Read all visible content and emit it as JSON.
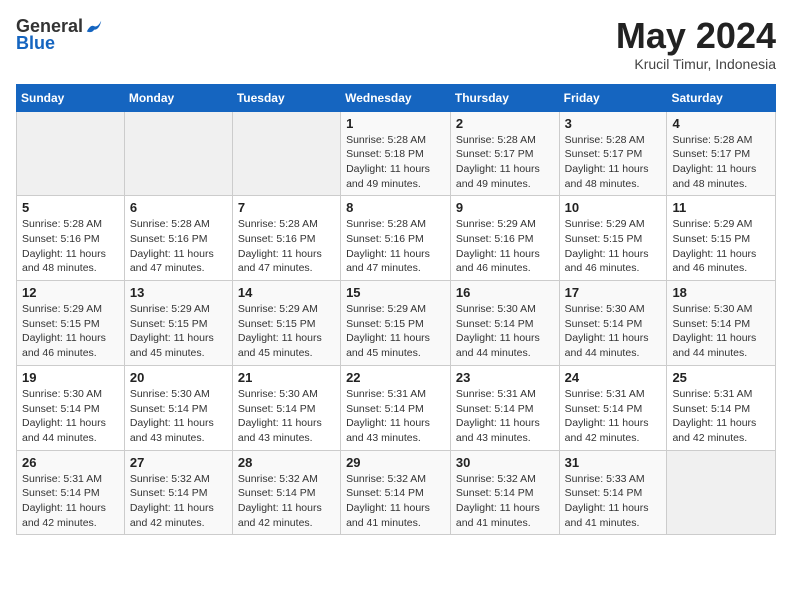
{
  "logo": {
    "general": "General",
    "blue": "Blue"
  },
  "title": "May 2024",
  "subtitle": "Krucil Timur, Indonesia",
  "days_header": [
    "Sunday",
    "Monday",
    "Tuesday",
    "Wednesday",
    "Thursday",
    "Friday",
    "Saturday"
  ],
  "weeks": [
    [
      {
        "day": "",
        "sunrise": "",
        "sunset": "",
        "daylight": ""
      },
      {
        "day": "",
        "sunrise": "",
        "sunset": "",
        "daylight": ""
      },
      {
        "day": "",
        "sunrise": "",
        "sunset": "",
        "daylight": ""
      },
      {
        "day": "1",
        "sunrise": "Sunrise: 5:28 AM",
        "sunset": "Sunset: 5:18 PM",
        "daylight": "Daylight: 11 hours and 49 minutes."
      },
      {
        "day": "2",
        "sunrise": "Sunrise: 5:28 AM",
        "sunset": "Sunset: 5:17 PM",
        "daylight": "Daylight: 11 hours and 49 minutes."
      },
      {
        "day": "3",
        "sunrise": "Sunrise: 5:28 AM",
        "sunset": "Sunset: 5:17 PM",
        "daylight": "Daylight: 11 hours and 48 minutes."
      },
      {
        "day": "4",
        "sunrise": "Sunrise: 5:28 AM",
        "sunset": "Sunset: 5:17 PM",
        "daylight": "Daylight: 11 hours and 48 minutes."
      }
    ],
    [
      {
        "day": "5",
        "sunrise": "Sunrise: 5:28 AM",
        "sunset": "Sunset: 5:16 PM",
        "daylight": "Daylight: 11 hours and 48 minutes."
      },
      {
        "day": "6",
        "sunrise": "Sunrise: 5:28 AM",
        "sunset": "Sunset: 5:16 PM",
        "daylight": "Daylight: 11 hours and 47 minutes."
      },
      {
        "day": "7",
        "sunrise": "Sunrise: 5:28 AM",
        "sunset": "Sunset: 5:16 PM",
        "daylight": "Daylight: 11 hours and 47 minutes."
      },
      {
        "day": "8",
        "sunrise": "Sunrise: 5:28 AM",
        "sunset": "Sunset: 5:16 PM",
        "daylight": "Daylight: 11 hours and 47 minutes."
      },
      {
        "day": "9",
        "sunrise": "Sunrise: 5:29 AM",
        "sunset": "Sunset: 5:16 PM",
        "daylight": "Daylight: 11 hours and 46 minutes."
      },
      {
        "day": "10",
        "sunrise": "Sunrise: 5:29 AM",
        "sunset": "Sunset: 5:15 PM",
        "daylight": "Daylight: 11 hours and 46 minutes."
      },
      {
        "day": "11",
        "sunrise": "Sunrise: 5:29 AM",
        "sunset": "Sunset: 5:15 PM",
        "daylight": "Daylight: 11 hours and 46 minutes."
      }
    ],
    [
      {
        "day": "12",
        "sunrise": "Sunrise: 5:29 AM",
        "sunset": "Sunset: 5:15 PM",
        "daylight": "Daylight: 11 hours and 46 minutes."
      },
      {
        "day": "13",
        "sunrise": "Sunrise: 5:29 AM",
        "sunset": "Sunset: 5:15 PM",
        "daylight": "Daylight: 11 hours and 45 minutes."
      },
      {
        "day": "14",
        "sunrise": "Sunrise: 5:29 AM",
        "sunset": "Sunset: 5:15 PM",
        "daylight": "Daylight: 11 hours and 45 minutes."
      },
      {
        "day": "15",
        "sunrise": "Sunrise: 5:29 AM",
        "sunset": "Sunset: 5:15 PM",
        "daylight": "Daylight: 11 hours and 45 minutes."
      },
      {
        "day": "16",
        "sunrise": "Sunrise: 5:30 AM",
        "sunset": "Sunset: 5:14 PM",
        "daylight": "Daylight: 11 hours and 44 minutes."
      },
      {
        "day": "17",
        "sunrise": "Sunrise: 5:30 AM",
        "sunset": "Sunset: 5:14 PM",
        "daylight": "Daylight: 11 hours and 44 minutes."
      },
      {
        "day": "18",
        "sunrise": "Sunrise: 5:30 AM",
        "sunset": "Sunset: 5:14 PM",
        "daylight": "Daylight: 11 hours and 44 minutes."
      }
    ],
    [
      {
        "day": "19",
        "sunrise": "Sunrise: 5:30 AM",
        "sunset": "Sunset: 5:14 PM",
        "daylight": "Daylight: 11 hours and 44 minutes."
      },
      {
        "day": "20",
        "sunrise": "Sunrise: 5:30 AM",
        "sunset": "Sunset: 5:14 PM",
        "daylight": "Daylight: 11 hours and 43 minutes."
      },
      {
        "day": "21",
        "sunrise": "Sunrise: 5:30 AM",
        "sunset": "Sunset: 5:14 PM",
        "daylight": "Daylight: 11 hours and 43 minutes."
      },
      {
        "day": "22",
        "sunrise": "Sunrise: 5:31 AM",
        "sunset": "Sunset: 5:14 PM",
        "daylight": "Daylight: 11 hours and 43 minutes."
      },
      {
        "day": "23",
        "sunrise": "Sunrise: 5:31 AM",
        "sunset": "Sunset: 5:14 PM",
        "daylight": "Daylight: 11 hours and 43 minutes."
      },
      {
        "day": "24",
        "sunrise": "Sunrise: 5:31 AM",
        "sunset": "Sunset: 5:14 PM",
        "daylight": "Daylight: 11 hours and 42 minutes."
      },
      {
        "day": "25",
        "sunrise": "Sunrise: 5:31 AM",
        "sunset": "Sunset: 5:14 PM",
        "daylight": "Daylight: 11 hours and 42 minutes."
      }
    ],
    [
      {
        "day": "26",
        "sunrise": "Sunrise: 5:31 AM",
        "sunset": "Sunset: 5:14 PM",
        "daylight": "Daylight: 11 hours and 42 minutes."
      },
      {
        "day": "27",
        "sunrise": "Sunrise: 5:32 AM",
        "sunset": "Sunset: 5:14 PM",
        "daylight": "Daylight: 11 hours and 42 minutes."
      },
      {
        "day": "28",
        "sunrise": "Sunrise: 5:32 AM",
        "sunset": "Sunset: 5:14 PM",
        "daylight": "Daylight: 11 hours and 42 minutes."
      },
      {
        "day": "29",
        "sunrise": "Sunrise: 5:32 AM",
        "sunset": "Sunset: 5:14 PM",
        "daylight": "Daylight: 11 hours and 41 minutes."
      },
      {
        "day": "30",
        "sunrise": "Sunrise: 5:32 AM",
        "sunset": "Sunset: 5:14 PM",
        "daylight": "Daylight: 11 hours and 41 minutes."
      },
      {
        "day": "31",
        "sunrise": "Sunrise: 5:33 AM",
        "sunset": "Sunset: 5:14 PM",
        "daylight": "Daylight: 11 hours and 41 minutes."
      },
      {
        "day": "",
        "sunrise": "",
        "sunset": "",
        "daylight": ""
      }
    ]
  ]
}
